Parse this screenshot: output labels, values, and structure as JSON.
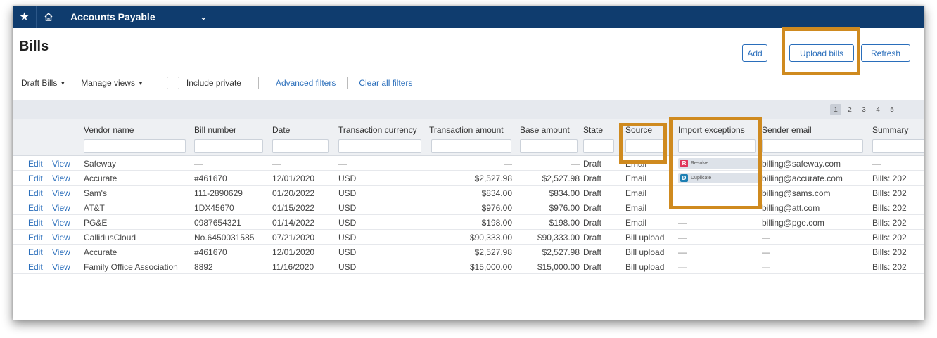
{
  "topbar": {
    "star_icon": "star-icon",
    "home_icon": "home-icon",
    "app_name": "Accounts Payable",
    "chevron_icon": "chevron-down-icon"
  },
  "page": {
    "title": "Bills"
  },
  "actions": {
    "add": "Add",
    "upload": "Upload bills",
    "refresh": "Refresh"
  },
  "filters": {
    "view": "Draft Bills",
    "manage": "Manage views",
    "include_private": "Include private",
    "advanced": "Advanced filters",
    "clear": "Clear all filters"
  },
  "pagination": [
    "1",
    "2",
    "3",
    "4",
    "5"
  ],
  "columns": [
    "Vendor name",
    "Bill number",
    "Date",
    "Transaction currency",
    "Transaction amount",
    "Base amount",
    "State",
    "Source",
    "Import exceptions",
    "Sender email",
    "Summary"
  ],
  "row_actions": {
    "edit": "Edit",
    "view": "View"
  },
  "rows": [
    {
      "vendor": "Safeway",
      "bill": "—",
      "date": "—",
      "currency": "—",
      "amount": "—",
      "base": "—",
      "state": "Draft",
      "source": "Email",
      "exception": {
        "letter": "R",
        "label": "Resolve",
        "color": "#e0355a"
      },
      "email": "billing@safeway.com",
      "summary": "—"
    },
    {
      "vendor": "Accurate",
      "bill": "#461670",
      "date": "12/01/2020",
      "currency": "USD",
      "amount": "$2,527.98",
      "base": "$2,527.98",
      "state": "Draft",
      "source": "Email",
      "exception": {
        "letter": "D",
        "label": "Duplicate",
        "color": "#1d7fb3"
      },
      "email": "billing@accurate.com",
      "summary": "Bills: 202"
    },
    {
      "vendor": "Sam's",
      "bill": "111-2890629",
      "date": "01/20/2022",
      "currency": "USD",
      "amount": "$834.00",
      "base": "$834.00",
      "state": "Draft",
      "source": "Email",
      "exception": null,
      "email": "billing@sams.com",
      "summary": "Bills: 202"
    },
    {
      "vendor": "AT&T",
      "bill": "1DX45670",
      "date": "01/15/2022",
      "currency": "USD",
      "amount": "$976.00",
      "base": "$976.00",
      "state": "Draft",
      "source": "Email",
      "exception": "—",
      "email": "billing@att.com",
      "summary": "Bills: 202"
    },
    {
      "vendor": "PG&E",
      "bill": "0987654321",
      "date": "01/14/2022",
      "currency": "USD",
      "amount": "$198.00",
      "base": "$198.00",
      "state": "Draft",
      "source": "Email",
      "exception": "—",
      "email": "billing@pge.com",
      "summary": "Bills: 202"
    },
    {
      "vendor": "CallidusCloud",
      "bill": "No.6450031585",
      "date": "07/21/2020",
      "currency": "USD",
      "amount": "$90,333.00",
      "base": "$90,333.00",
      "state": "Draft",
      "source": "Bill upload",
      "exception": "—",
      "email": "—",
      "summary": "Bills: 202"
    },
    {
      "vendor": "Accurate",
      "bill": "#461670",
      "date": "12/01/2020",
      "currency": "USD",
      "amount": "$2,527.98",
      "base": "$2,527.98",
      "state": "Draft",
      "source": "Bill upload",
      "exception": "—",
      "email": "—",
      "summary": "Bills: 202"
    },
    {
      "vendor": "Family Office Association",
      "bill": "8892",
      "date": "11/16/2020",
      "currency": "USD",
      "amount": "$15,000.00",
      "base": "$15,000.00",
      "state": "Draft",
      "source": "Bill upload",
      "exception": "—",
      "email": "—",
      "summary": "Bills: 202"
    }
  ],
  "colors": {
    "nav": "#0f3c6e",
    "link": "#2a6ebb",
    "highlight": "#cf8a1f",
    "band": "#e6e9ee"
  }
}
